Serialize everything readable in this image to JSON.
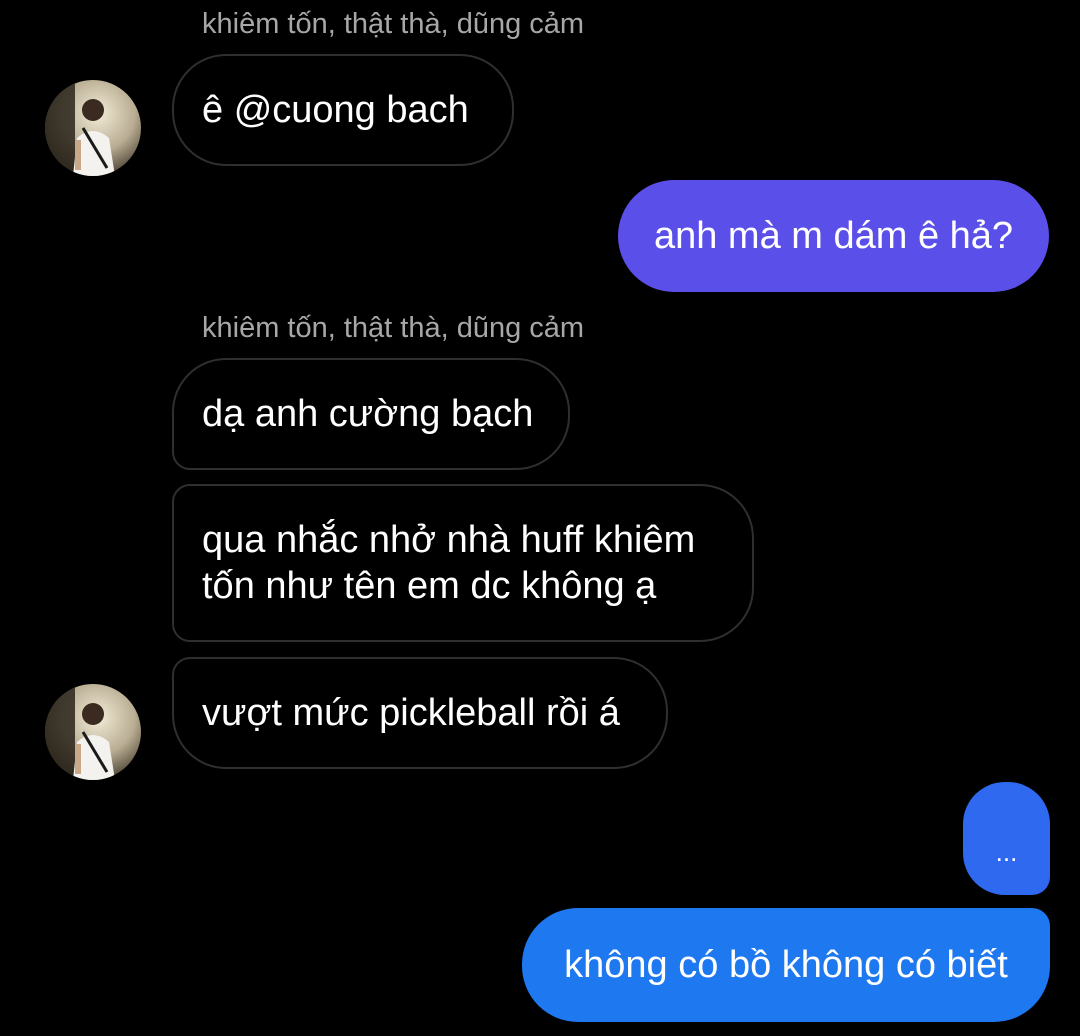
{
  "thread": {
    "sender_name": "khiêm tốn, thật thà, dũng cảm",
    "messages": [
      {
        "text": "ê @cuong bach"
      },
      {
        "text": "anh mà m dám ê hả?"
      },
      {
        "text": "dạ anh cường bạch"
      },
      {
        "text_line1": "qua nhắc nhở nhà huff khiêm",
        "text_line2": "tốn như tên em dc không ạ"
      },
      {
        "text": "vượt mức pickleball rồi á"
      },
      {
        "text": "..."
      },
      {
        "text": "không có bồ không có biết"
      }
    ]
  },
  "colors": {
    "background": "#000000",
    "incoming_border": "#2f2f2f",
    "outgoing_purple": "#5b4fe9",
    "outgoing_blue_mid": "#2e69f0",
    "outgoing_blue": "#1e78f0",
    "sender_name": "#a7a7a7"
  },
  "icons": {
    "avatar": "user-avatar-photo"
  }
}
